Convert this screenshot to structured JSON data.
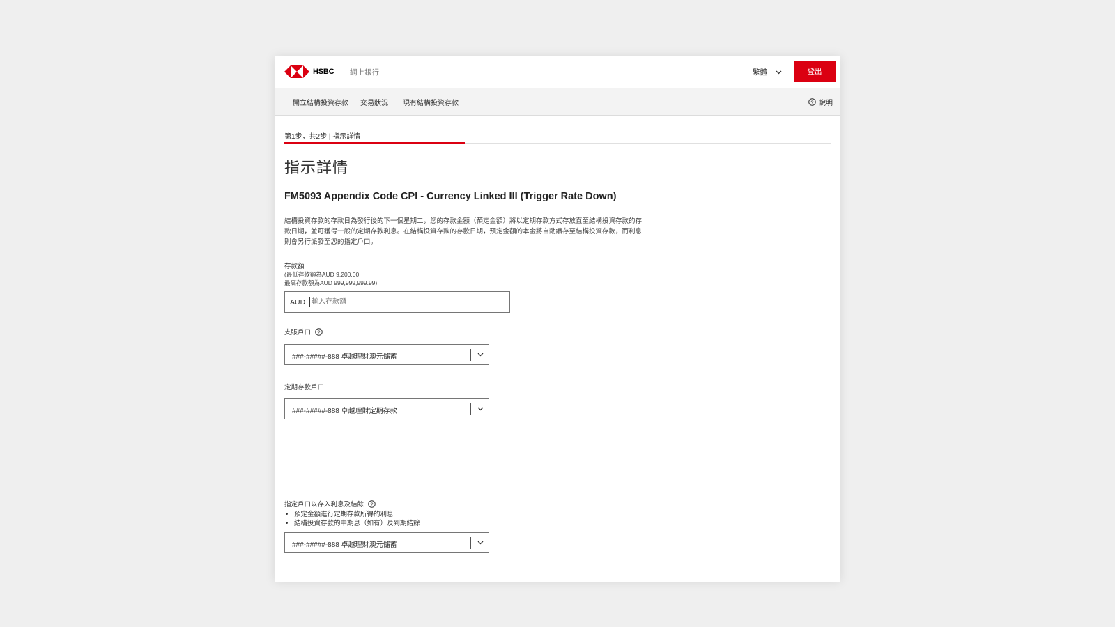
{
  "header": {
    "brand": "HSBC",
    "portal": "網上銀行",
    "language": "繁體",
    "logout_label": "登出"
  },
  "nav": {
    "items": [
      {
        "label": "開立結構投資存款"
      },
      {
        "label": "交易狀況"
      },
      {
        "label": "現有結構投資存款"
      }
    ],
    "help_label": "說明"
  },
  "progress": {
    "step_text": "第1步，共2步 | 指示詳情",
    "fraction": 0.33
  },
  "page": {
    "title": "指示詳情",
    "product": "FM5093 Appendix Code CPI - Currency Linked III (Trigger Rate Down)",
    "description": "結構投資存款的存款日為發行後的下一個星期二，您的存款金額（預定金額）將以定期存款方式存放直至結構投資存款的存款日期，並可獲得一般的定期存款利息。在結構投資存款的存款日期，預定金額的本金將自動續存至結構投資存款，而利息則會另行派發至您的指定戶口。"
  },
  "amount": {
    "label": "存款額",
    "min_note": "(最低存款額為AUD 9,200.00;",
    "max_note": "最高存款額為AUD 999,999,999.99)",
    "currency": "AUD",
    "placeholder": "輸入存款額",
    "value": ""
  },
  "debit_account": {
    "label": "支賬戶口",
    "value": "###-#####-888 卓越理財澳元儲蓄"
  },
  "deposit_account": {
    "label": "定期存款戶口",
    "value": "###-#####-888 卓越理財定期存款"
  },
  "interest_account": {
    "label": "指定戶口以存入利息及結餘",
    "bullets": [
      "預定金額進行定期存款所得的利息",
      "結構投資存款的中期息（如有）及到期結餘"
    ],
    "value": "###-#####-888 卓越理財澳元儲蓄"
  },
  "colors": {
    "brand_red": "#db0011",
    "background": "#efefef"
  },
  "icons": [
    "hsbc-logo-icon",
    "chevron-down-icon",
    "help-circle-icon"
  ]
}
